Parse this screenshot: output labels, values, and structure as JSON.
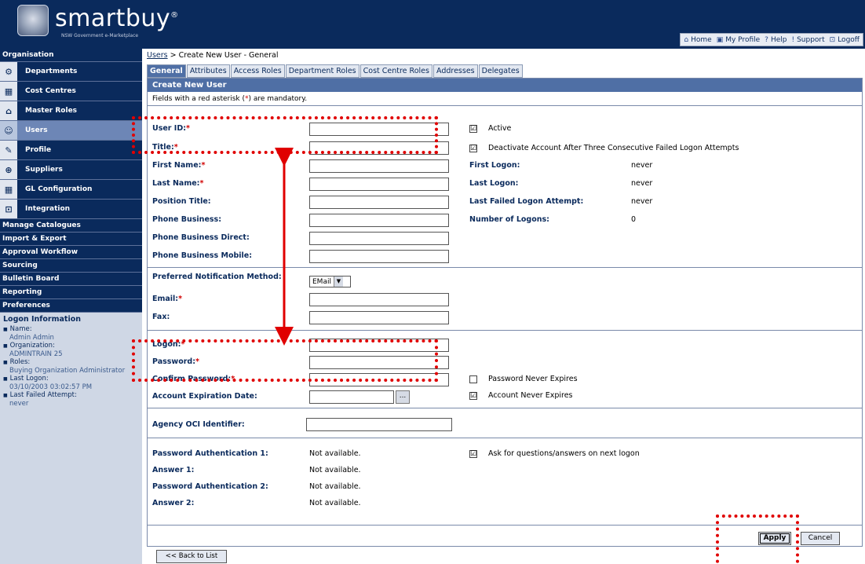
{
  "header": {
    "logo": "smartbuy",
    "logo_mark": "®",
    "tagline": "NSW Government e-Marketplace",
    "nav": [
      {
        "icon": "home-icon",
        "glyph": "⌂",
        "label": "Home"
      },
      {
        "icon": "profile-icon",
        "glyph": "▣",
        "label": "My Profile"
      },
      {
        "icon": "help-icon",
        "glyph": "?",
        "label": "Help"
      },
      {
        "icon": "support-icon",
        "glyph": "!",
        "label": "Support"
      },
      {
        "icon": "logoff-icon",
        "glyph": "⊡",
        "label": "Logoff"
      }
    ]
  },
  "sidebar": {
    "organisation_label": "Organisation",
    "items": [
      {
        "label": "Departments",
        "icon": "departments-icon",
        "glyph": "⚙"
      },
      {
        "label": "Cost Centres",
        "icon": "cost-centres-icon",
        "glyph": "▦"
      },
      {
        "label": "Master Roles",
        "icon": "master-roles-icon",
        "glyph": "⌂"
      },
      {
        "label": "Users",
        "icon": "users-icon",
        "glyph": "☺",
        "active": true
      },
      {
        "label": "Profile",
        "icon": "profile-icon",
        "glyph": "✎"
      },
      {
        "label": "Suppliers",
        "icon": "suppliers-icon",
        "glyph": "⊕"
      },
      {
        "label": "GL Configuration",
        "icon": "gl-configuration-icon",
        "glyph": "▦"
      },
      {
        "label": "Integration",
        "icon": "integration-icon",
        "glyph": "⊡"
      }
    ],
    "sections": [
      "Manage Catalogues",
      "Import & Export",
      "Approval Workflow",
      "Sourcing",
      "Bulletin Board",
      "Reporting",
      "Preferences"
    ],
    "logon_info": {
      "title": "Logon Information",
      "name_label": "Name:",
      "name": "Admin Admin",
      "org_label": "Organization:",
      "org": "ADMINTRAIN 25",
      "roles_label": "Roles:",
      "roles": "Buying Organization Administrator",
      "last_logon_label": "Last Logon:",
      "last_logon": "03/10/2003 03:02:57 PM",
      "last_failed_label": "Last Failed Attempt:",
      "last_failed": "never"
    }
  },
  "breadcrumb": {
    "link": "Users",
    "rest": " > Create New User - General"
  },
  "tabs": [
    "General",
    "Attributes",
    "Access Roles",
    "Department Roles",
    "Cost Centre Roles",
    "Addresses",
    "Delegates"
  ],
  "panel": {
    "title": "Create New User",
    "note_before": "Fields with a red asterisk (",
    "note_star": "*",
    "note_after": ") are mandatory."
  },
  "form": {
    "user_id": "User ID:",
    "title": "Title:",
    "first_name": "First Name:",
    "last_name": "Last Name:",
    "position_title": "Position Title:",
    "phone_business": "Phone Business:",
    "phone_business_direct": "Phone Business Direct:",
    "phone_business_mobile": "Phone Business Mobile:",
    "preferred_notification": "Preferred Notification Method:",
    "notification_value": "EMail",
    "email": "Email:",
    "fax": "Fax:",
    "logon": "Logon:",
    "password": "Password:",
    "confirm_password": "Confirm Password:",
    "account_expiration": "Account Expiration Date:",
    "agency_oci": "Agency OCI Identifier:",
    "auth1": "Password Authentication 1:",
    "auth1_value": "Not available.",
    "answer1": "Answer 1:",
    "answer1_value": "Not available.",
    "auth2": "Password Authentication 2:",
    "auth2_value": "Not available.",
    "answer2": "Answer 2:",
    "answer2_value": "Not available."
  },
  "right": {
    "active": "Active",
    "deactivate": "Deactivate Account After Three Consecutive Failed Logon Attempts",
    "first_logon": "First Logon:",
    "first_logon_value": "never",
    "last_logon": "Last Logon:",
    "last_logon_value": "never",
    "last_failed": "Last Failed Logon Attempt:",
    "last_failed_value": "never",
    "num_logons": "Number of Logons:",
    "num_logons_value": "0",
    "password_never_expires": "Password Never Expires",
    "account_never_expires": "Account Never Expires",
    "ask_questions": "Ask for questions/answers on next logon",
    "active_checked": "☑",
    "deactivate_checked": "☑",
    "account_never_checked": "☑",
    "ask_checked": "☑"
  },
  "buttons": {
    "apply": "Apply",
    "cancel": "Cancel",
    "back": "<< Back to List",
    "date_picker": "..."
  },
  "annotation_color": "#e00000"
}
